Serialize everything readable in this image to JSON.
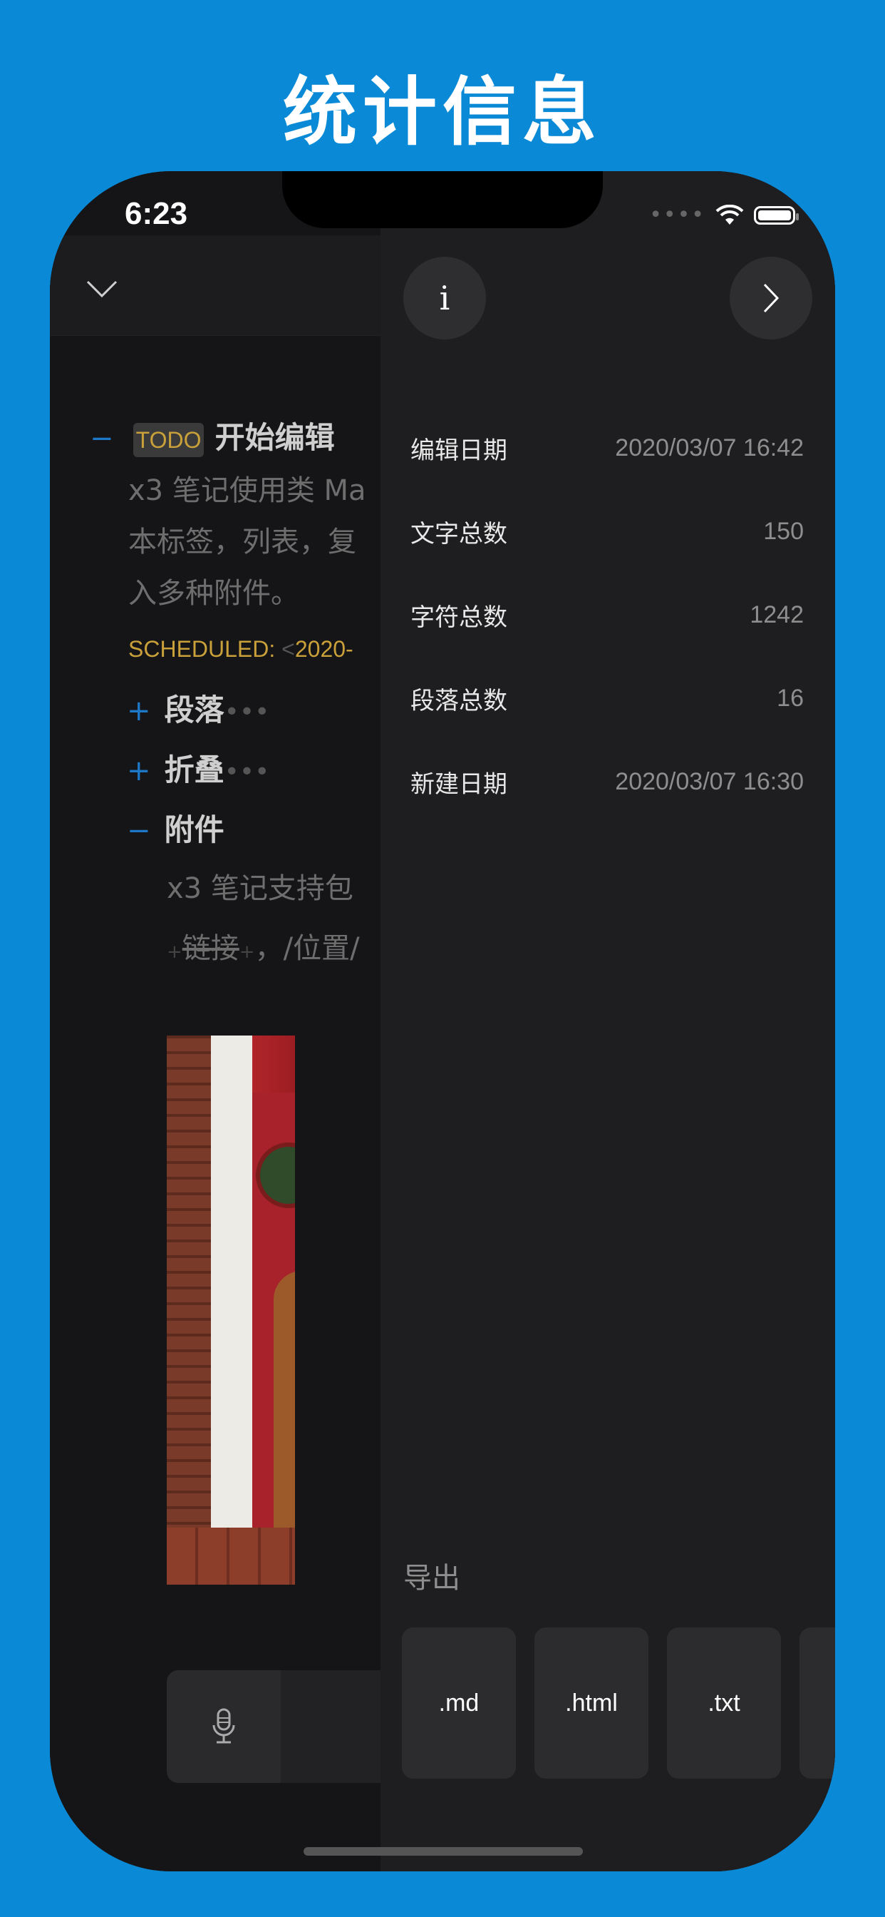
{
  "headline": "统计信息",
  "status_bar": {
    "time": "6:23"
  },
  "editor": {
    "todo_badge": "TODO",
    "heading": "开始编辑",
    "body_lines": [
      "x3 笔记使用类 Ma",
      "本标签，列表，复",
      "入多种附件。"
    ],
    "scheduled_label": "SCHEDULED:",
    "scheduled_date": "2020-",
    "sections": [
      {
        "marker": "+",
        "title": "段落",
        "suffix": "•••"
      },
      {
        "marker": "+",
        "title": "折叠",
        "suffix": "•••"
      },
      {
        "marker": "−",
        "title": "附件",
        "suffix": ""
      }
    ],
    "attach_line1": "x3 笔记支持包",
    "attach_line2": "链接",
    "attach_line2_rest": "，/位置/"
  },
  "panel": {
    "stats": [
      {
        "label": "编辑日期",
        "value": "2020/03/07 16:42"
      },
      {
        "label": "文字总数",
        "value": "150"
      },
      {
        "label": "字符总数",
        "value": "1242"
      },
      {
        "label": "段落总数",
        "value": "16"
      },
      {
        "label": "新建日期",
        "value": "2020/03/07 16:30"
      }
    ],
    "export_title": "导出",
    "export_buttons": [
      ".md",
      ".html",
      ".txt"
    ]
  },
  "icons": {
    "collapse": "chevron-down-icon",
    "info": "info-icon",
    "next": "chevron-right-icon",
    "mic": "microphone-icon"
  },
  "colors": {
    "background": "#0a8ad6",
    "accent_blue": "#1e78c8",
    "todo_gold": "#c9a03a"
  }
}
